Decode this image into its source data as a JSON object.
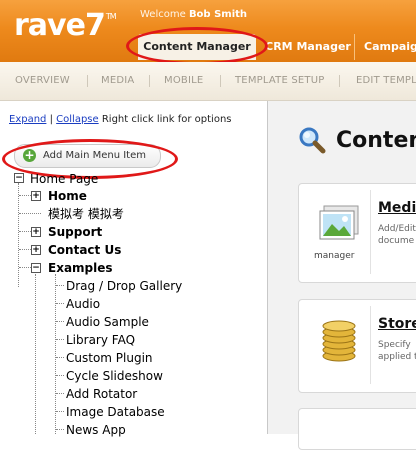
{
  "header": {
    "logo": "rave7",
    "logo_tm": "TM",
    "welcome_prefix": "Welcome",
    "welcome_user": "Bob Smith",
    "tabs": [
      {
        "label": "Content Manager",
        "active": true
      },
      {
        "label": "CRM Manager",
        "active": false
      },
      {
        "label": "Campaign",
        "active": false
      }
    ]
  },
  "subnav": {
    "items": [
      "OVERVIEW",
      "MEDIA",
      "MOBILE",
      "TEMPLATE SETUP",
      "EDIT TEMPLA"
    ]
  },
  "sidebar": {
    "expand_label": "Expand",
    "separator": "|",
    "collapse_label": "Collapse",
    "hint": "Right click link for options",
    "add_button_label": "Add Main Menu Item",
    "tree": {
      "root": "Home Page",
      "children": [
        {
          "label": "Home",
          "bold": true,
          "expander": "+"
        },
        {
          "label": "模拟考 模拟考",
          "bold": false,
          "expander": ""
        },
        {
          "label": "Support",
          "bold": true,
          "expander": "+"
        },
        {
          "label": "Contact Us",
          "bold": true,
          "expander": "+"
        },
        {
          "label": "Examples",
          "bold": true,
          "expander": "−"
        }
      ],
      "examples": [
        "Drag / Drop Gallery",
        "Audio",
        "Audio Sample",
        "Library FAQ",
        "Custom Plugin",
        "Cycle Slideshow",
        "Add Rotator",
        "Image Database",
        "News App"
      ]
    }
  },
  "main": {
    "title": "Content",
    "cards": [
      {
        "title": "Media",
        "desc_line1": "Add/Edit",
        "desc_line2": "docume",
        "caption": "manager",
        "icon": "media-image-icon"
      },
      {
        "title": "Store",
        "desc_line1": "Specify",
        "desc_line2": "applied t",
        "icon": "coins-icon"
      }
    ]
  },
  "colors": {
    "header_orange": "#ee8a1d",
    "highlight_red": "#e01818",
    "link_blue": "#1a3dc1",
    "plus_green": "#57a63a"
  }
}
